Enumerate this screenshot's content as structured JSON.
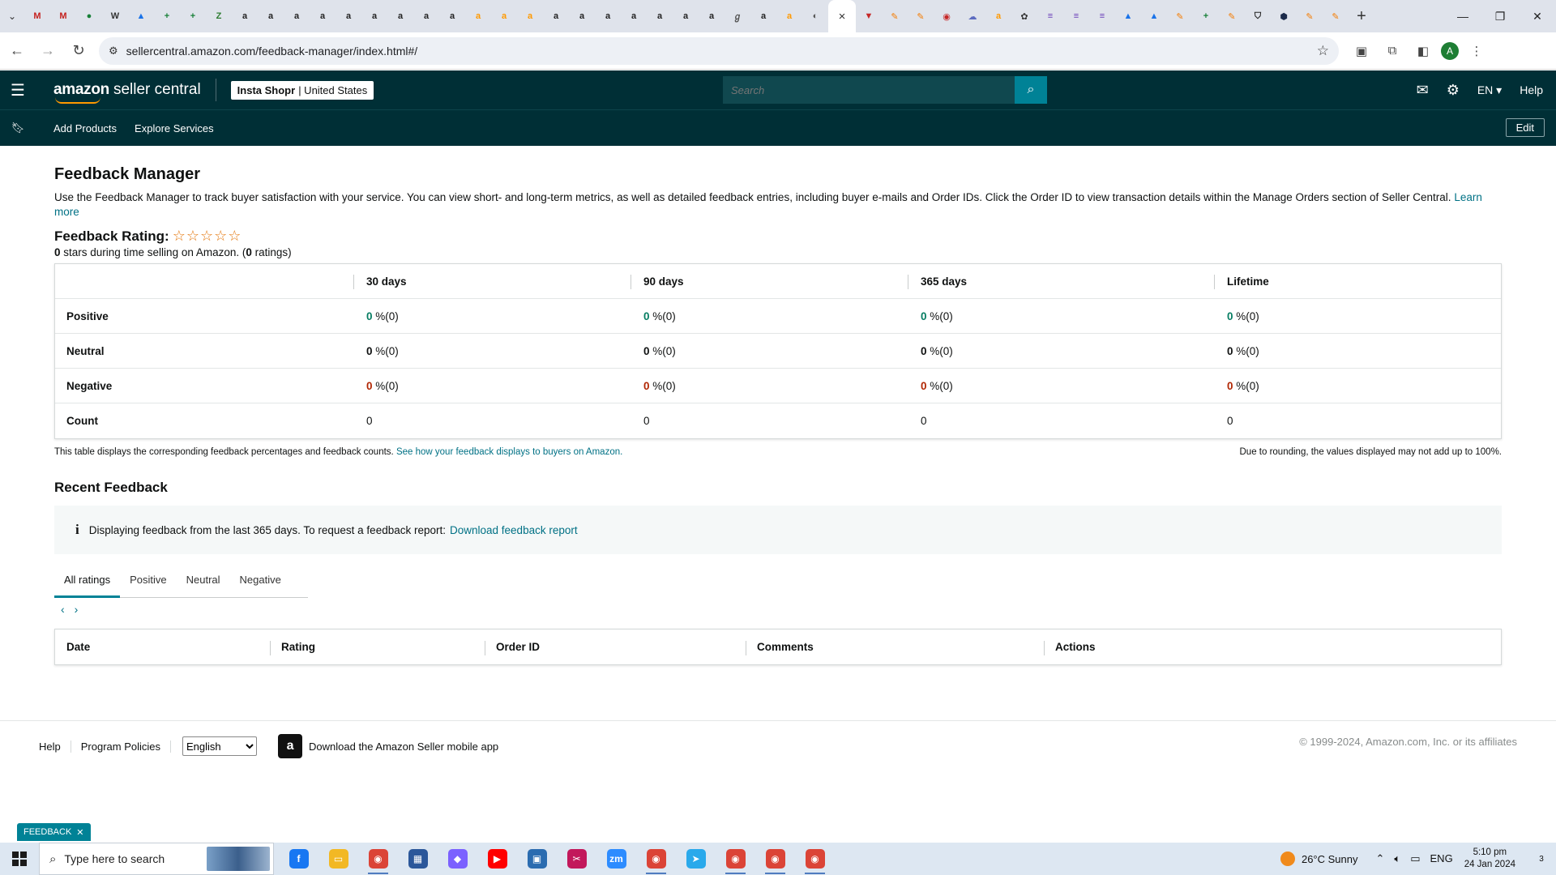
{
  "browser": {
    "tab_favicons": [
      {
        "icon": "gmail-icon",
        "color": "#c5221f",
        "glyph": "M"
      },
      {
        "icon": "gmail-icon",
        "color": "#c5221f",
        "glyph": "M"
      },
      {
        "icon": "circle-app-icon",
        "color": "#188038",
        "glyph": "●"
      },
      {
        "icon": "wix-icon",
        "color": "#333333",
        "glyph": "W"
      },
      {
        "icon": "drive-icon",
        "color": "#1a73e8",
        "glyph": "▲"
      },
      {
        "icon": "sheets-icon",
        "color": "#188038",
        "glyph": "+"
      },
      {
        "icon": "sheets-icon",
        "color": "#188038",
        "glyph": "+"
      },
      {
        "icon": "green-app-icon",
        "color": "#2e7d32",
        "glyph": "Z"
      },
      {
        "icon": "amazon-icon",
        "color": "#222222",
        "glyph": "a"
      },
      {
        "icon": "amazon-icon",
        "color": "#222222",
        "glyph": "a"
      },
      {
        "icon": "amazon-icon",
        "color": "#222222",
        "glyph": "a"
      },
      {
        "icon": "amazon-icon",
        "color": "#222222",
        "glyph": "a"
      },
      {
        "icon": "amazon-icon",
        "color": "#222222",
        "glyph": "a"
      },
      {
        "icon": "amazon-icon",
        "color": "#222222",
        "glyph": "a"
      },
      {
        "icon": "amazon-icon",
        "color": "#222222",
        "glyph": "a"
      },
      {
        "icon": "amazon-icon",
        "color": "#222222",
        "glyph": "a"
      },
      {
        "icon": "amazon-icon",
        "color": "#222222",
        "glyph": "a"
      },
      {
        "icon": "amazon-smile-icon",
        "color": "#ff9900",
        "glyph": "a"
      },
      {
        "icon": "amazon-smile-icon",
        "color": "#ff9900",
        "glyph": "a"
      },
      {
        "icon": "amazon-smile-icon",
        "color": "#ff9900",
        "glyph": "a"
      },
      {
        "icon": "amazon-icon",
        "color": "#222222",
        "glyph": "a"
      },
      {
        "icon": "amazon-icon",
        "color": "#222222",
        "glyph": "a"
      },
      {
        "icon": "amazon-icon",
        "color": "#222222",
        "glyph": "a"
      },
      {
        "icon": "amazon-icon",
        "color": "#222222",
        "glyph": "a"
      },
      {
        "icon": "amazon-icon",
        "color": "#222222",
        "glyph": "a"
      },
      {
        "icon": "amazon-icon",
        "color": "#222222",
        "glyph": "a"
      },
      {
        "icon": "amazon-icon",
        "color": "#222222",
        "glyph": "a"
      },
      {
        "icon": "script-icon",
        "color": "#555555",
        "glyph": "ℊ"
      },
      {
        "icon": "amazon-icon",
        "color": "#222222",
        "glyph": "a"
      },
      {
        "icon": "amazon-smile-icon",
        "color": "#ff9900",
        "glyph": "a"
      },
      {
        "icon": "globe-icon",
        "color": "#555555",
        "glyph": "◐"
      }
    ],
    "active_tab_close": "×",
    "tab_favicons_after": [
      {
        "icon": "vivaldi-icon",
        "color": "#c62828",
        "glyph": "▼"
      },
      {
        "icon": "pen-icon",
        "color": "#f57c00",
        "glyph": "✎"
      },
      {
        "icon": "pen-icon",
        "color": "#f57c00",
        "glyph": "✎"
      },
      {
        "icon": "red-circle-icon",
        "color": "#c62828",
        "glyph": "◉"
      },
      {
        "icon": "cloud-icon",
        "color": "#5c6bc0",
        "glyph": "☁"
      },
      {
        "icon": "amazon-smile-icon",
        "color": "#ff9900",
        "glyph": "a"
      },
      {
        "icon": "openai-icon",
        "color": "#333333",
        "glyph": "✿"
      },
      {
        "icon": "forms-icon",
        "color": "#673ab7",
        "glyph": "≡"
      },
      {
        "icon": "forms-icon",
        "color": "#673ab7",
        "glyph": "≡"
      },
      {
        "icon": "forms-icon",
        "color": "#673ab7",
        "glyph": "≡"
      },
      {
        "icon": "drive-icon",
        "color": "#1a73e8",
        "glyph": "▲"
      },
      {
        "icon": "drive-icon",
        "color": "#1a73e8",
        "glyph": "▲"
      },
      {
        "icon": "pen-icon",
        "color": "#f57c00",
        "glyph": "✎"
      },
      {
        "icon": "sheets-icon",
        "color": "#188038",
        "glyph": "+"
      },
      {
        "icon": "pen-icon",
        "color": "#f57c00",
        "glyph": "✎"
      },
      {
        "icon": "shield-icon",
        "color": "#222222",
        "glyph": "⛉"
      },
      {
        "icon": "hexagon-icon",
        "color": "#1b2a4a",
        "glyph": "⬢"
      },
      {
        "icon": "pen-icon",
        "color": "#f57c00",
        "glyph": "✎"
      },
      {
        "icon": "pen-icon",
        "color": "#f57c00",
        "glyph": "✎"
      }
    ],
    "new_tab_glyph": "+",
    "url": "sellercentral.amazon.com/feedback-manager/index.html#/"
  },
  "header": {
    "logo_bold": "amazon",
    "logo_text": "seller central",
    "store_name": "Insta Shopr",
    "store_region": "| United States",
    "search_placeholder": "Search",
    "language": "EN ▾",
    "help": "Help"
  },
  "nav": {
    "items": [
      "Add Products",
      "Explore Services"
    ],
    "edit": "Edit"
  },
  "page": {
    "title": "Feedback Manager",
    "description": "Use the Feedback Manager to track buyer satisfaction with your service. You can view short- and long-term metrics, as well as detailed feedback entries, including buyer e-mails and Order IDs. Click the Order ID to view transaction details within the Manage Orders section of Seller Central.",
    "learn_more": "Learn more",
    "rating_label": "Feedback Rating:",
    "stars_glyphs": "☆☆☆☆☆",
    "star_rating": 0,
    "rating_stars_value": "0",
    "rating_sub_mid": " stars during time selling on Amazon. (",
    "rating_count": "0",
    "rating_sub_end": " ratings)"
  },
  "summary_table": {
    "headers": [
      "",
      "30 days",
      "90 days",
      "365 days",
      "Lifetime"
    ],
    "rows": [
      {
        "label": "Positive",
        "kind": "green",
        "values": [
          {
            "n": "0",
            "p": " %(0)"
          },
          {
            "n": "0",
            "p": " %(0)"
          },
          {
            "n": "0",
            "p": " %(0)"
          },
          {
            "n": "0",
            "p": " %(0)"
          }
        ]
      },
      {
        "label": "Neutral",
        "kind": "plain",
        "values": [
          {
            "n": "0",
            "p": " %(0)"
          },
          {
            "n": "0",
            "p": " %(0)"
          },
          {
            "n": "0",
            "p": " %(0)"
          },
          {
            "n": "0",
            "p": " %(0)"
          }
        ]
      },
      {
        "label": "Negative",
        "kind": "red",
        "values": [
          {
            "n": "0",
            "p": " %(0)"
          },
          {
            "n": "0",
            "p": " %(0)"
          },
          {
            "n": "0",
            "p": " %(0)"
          },
          {
            "n": "0",
            "p": " %(0)"
          }
        ]
      },
      {
        "label": "Count",
        "kind": "count",
        "values": [
          {
            "n": "0",
            "p": ""
          },
          {
            "n": "0",
            "p": ""
          },
          {
            "n": "0",
            "p": ""
          },
          {
            "n": "0",
            "p": ""
          }
        ]
      }
    ],
    "footnote_left": "This table displays the corresponding feedback percentages and feedback counts.",
    "footnote_link": "See how your feedback displays to buyers on Amazon.",
    "footnote_right": "Due to rounding, the values displayed may not add up to 100%."
  },
  "recent": {
    "title": "Recent Feedback",
    "info_text": "Displaying feedback from the last 365 days. To request a feedback report:",
    "info_link": "Download feedback report",
    "tabs": [
      "All ratings",
      "Positive",
      "Neutral",
      "Negative"
    ],
    "active_tab": "All ratings",
    "columns": [
      "Date",
      "Rating",
      "Order ID",
      "Comments",
      "Actions"
    ]
  },
  "footer": {
    "links": [
      "Help",
      "Program Policies"
    ],
    "language_selected": "English",
    "app_download": "Download the Amazon Seller mobile app",
    "copyright": "© 1999-2024, Amazon.com, Inc. or its affiliates",
    "feedback_badge": "FEEDBACK"
  },
  "taskbar": {
    "search_placeholder": "Type here to search",
    "apps": [
      {
        "icon": "facebook-icon",
        "color": "#1877f2",
        "glyph": "f",
        "run": false
      },
      {
        "icon": "file-explorer-icon",
        "color": "#f2b824",
        "glyph": "▭",
        "run": false
      },
      {
        "icon": "chrome-icon",
        "color": "#db4437",
        "glyph": "◉",
        "run": true
      },
      {
        "icon": "calculator-icon",
        "color": "#2b579a",
        "glyph": "▦",
        "run": false
      },
      {
        "icon": "copilot-icon",
        "color": "#7b61ff",
        "glyph": "◆",
        "run": false
      },
      {
        "icon": "youtube-icon",
        "color": "#ff0000",
        "glyph": "▶",
        "run": false
      },
      {
        "icon": "store-icon",
        "color": "#2b6cb0",
        "glyph": "▣",
        "run": false
      },
      {
        "icon": "snipping-icon",
        "color": "#c2185b",
        "glyph": "✂",
        "run": false
      },
      {
        "icon": "zoom-icon",
        "color": "#2d8cff",
        "glyph": "zm",
        "run": false
      },
      {
        "icon": "chrome-icon",
        "color": "#db4437",
        "glyph": "◉",
        "run": true
      },
      {
        "icon": "telegram-icon",
        "color": "#29a9eb",
        "glyph": "➤",
        "run": false
      },
      {
        "icon": "chrome-icon",
        "color": "#db4437",
        "glyph": "◉",
        "run": true
      },
      {
        "icon": "chrome-icon",
        "color": "#db4437",
        "glyph": "◉",
        "run": true
      },
      {
        "icon": "chrome-icon",
        "color": "#db4437",
        "glyph": "◉",
        "run": true
      }
    ],
    "weather": "26°C  Sunny",
    "lang": "ENG",
    "time": "5:10 pm",
    "date": "24 Jan 2024",
    "notifications": "3"
  }
}
